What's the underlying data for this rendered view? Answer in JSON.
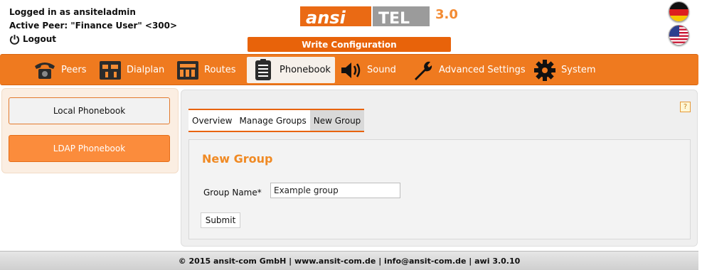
{
  "header": {
    "logged_in": "Logged in as ansiteladmin",
    "active_peer": "Active Peer: \"Finance User\" <300>",
    "logout": "Logout",
    "logo_text": "ansi TEL 3.0",
    "write_config": "Write Configuration"
  },
  "languages": [
    {
      "name": "german-flag"
    },
    {
      "name": "us-flag"
    }
  ],
  "nav": {
    "items": [
      {
        "label": "Peers",
        "icon": "phone-icon"
      },
      {
        "label": "Dialplan",
        "icon": "dialplan-icon"
      },
      {
        "label": "Routes",
        "icon": "routes-icon"
      },
      {
        "label": "Phonebook",
        "icon": "phonebook-icon",
        "active": true
      },
      {
        "label": "Sound",
        "icon": "speaker-icon"
      },
      {
        "label": "Advanced Settings",
        "icon": "wrench-icon"
      },
      {
        "label": "System",
        "icon": "gear-icon"
      }
    ]
  },
  "sidebar": {
    "local": "Local Phonebook",
    "ldap": "LDAP Phonebook"
  },
  "main": {
    "help": "?",
    "tabs": [
      "Overview",
      "Manage Groups",
      "New Group"
    ],
    "active_tab": "New Group",
    "title": "New Group",
    "field_label": "Group Name*",
    "field_value": "Example group",
    "submit": "Submit"
  },
  "footer": {
    "text": "© 2015 ansit-com GmbH | www.ansit-com.de | info@ansit-com.de | awi 3.0.10"
  },
  "colors": {
    "accent": "#ef7a1f",
    "title_orange": "#f08a24"
  }
}
